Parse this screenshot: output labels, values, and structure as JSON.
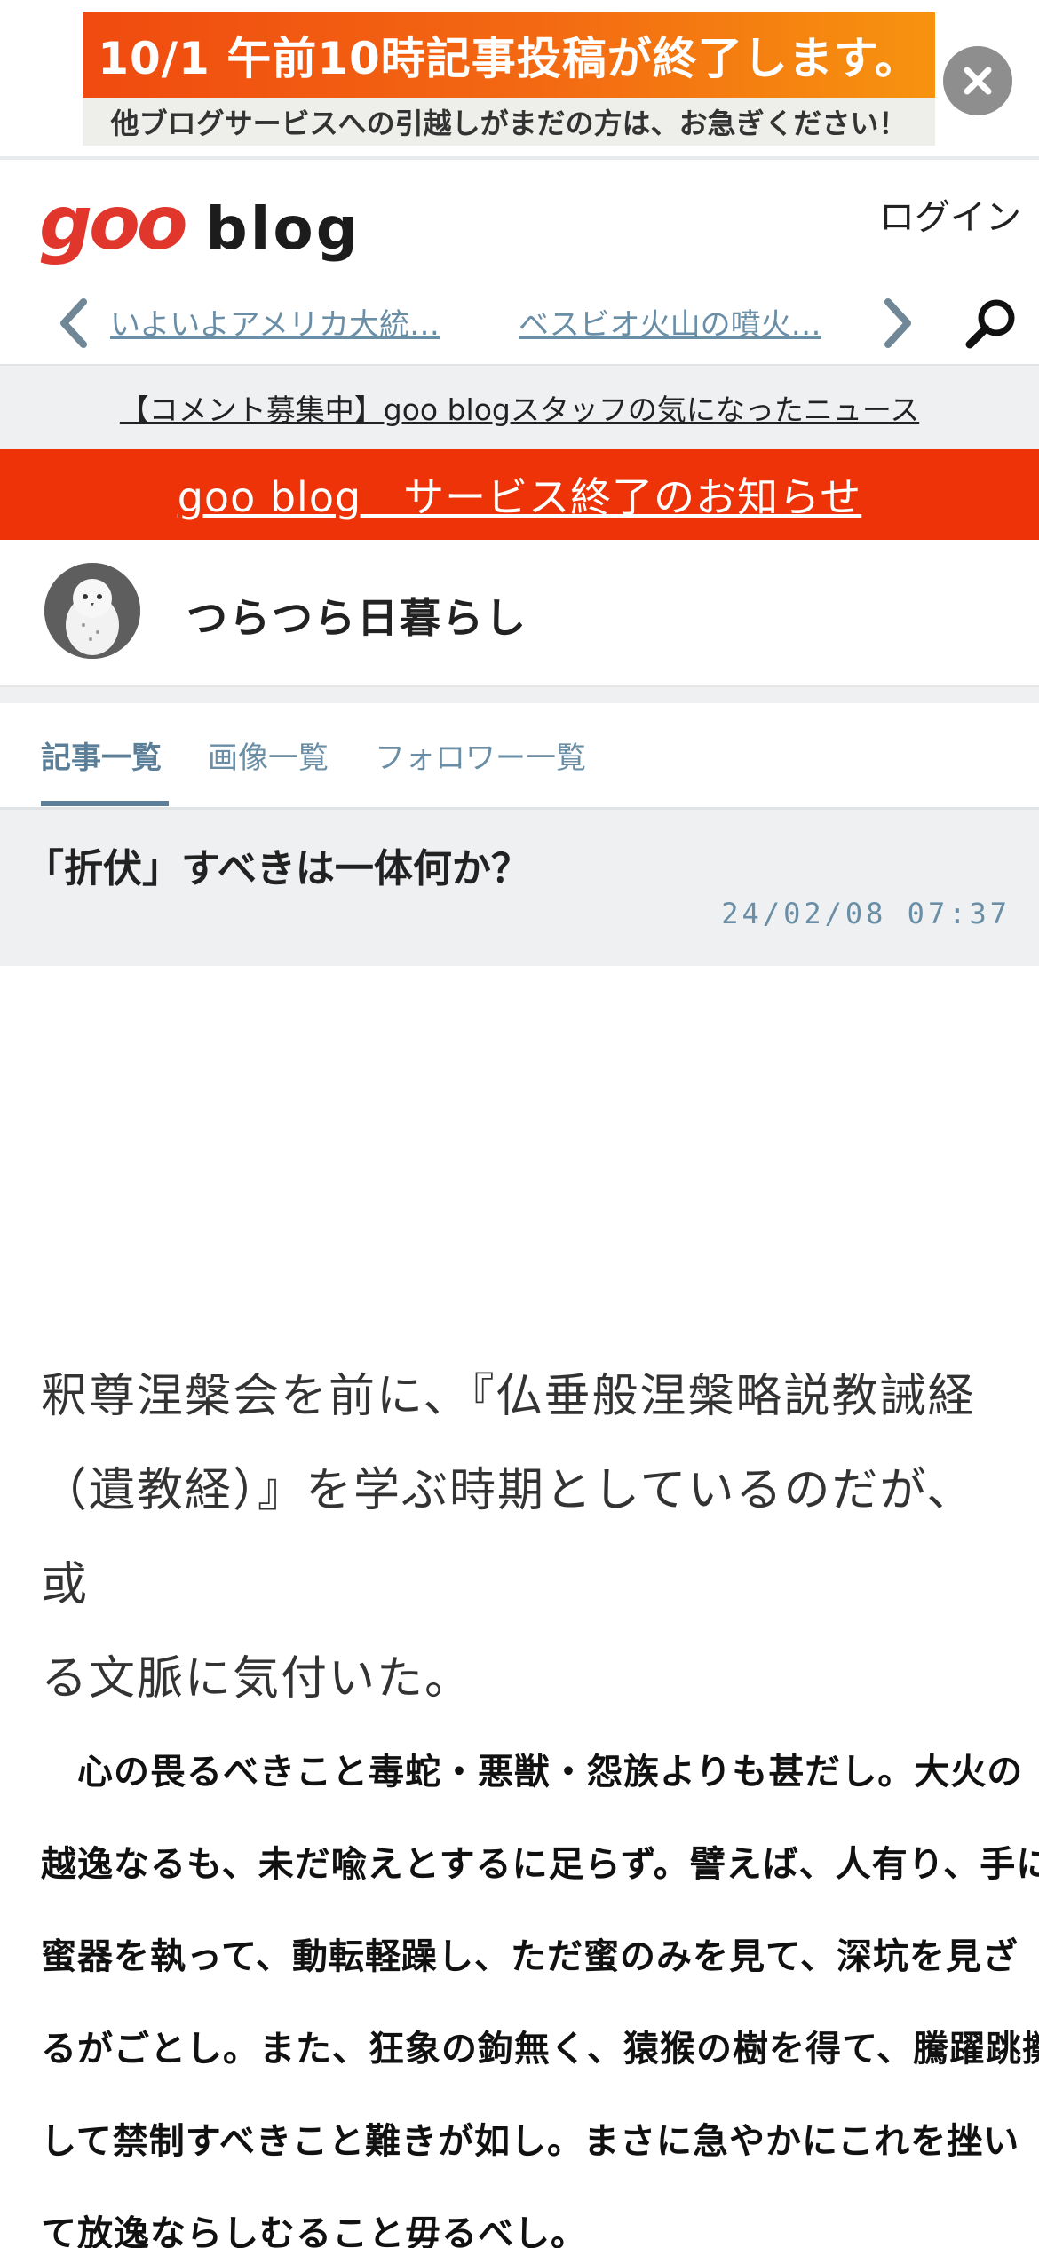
{
  "banner": {
    "headline": "10/1 午前10時記事投稿が終了します。",
    "subline": "他ブログサービスへの引越しがまだの方は、お急ぎください！"
  },
  "header": {
    "logo_goo": "goo",
    "logo_blog": "blog",
    "login_label": "ログイン",
    "news_links": [
      "いよいよアメリカ大統…",
      "ベスビオ火山の噴火…"
    ]
  },
  "comment_strip": "【コメント募集中】goo blogスタッフの気になったニュース",
  "notice": "goo blog　サービス終了のお知らせ",
  "blog": {
    "name": "つらつら日暮らし"
  },
  "tabs": [
    {
      "label": "記事一覧",
      "active": true
    },
    {
      "label": "画像一覧",
      "active": false
    },
    {
      "label": "フォロワー一覧",
      "active": false
    }
  ],
  "article": {
    "title": "「折伏」すべきは一体何か？",
    "date": "24/02/08 07:37",
    "intro_lines": [
      "釈尊涅槃会を前に、『仏垂般涅槃略説教誡経",
      "（遺教経）』を学ぶ時期としているのだが、或",
      "る文脈に気付いた。"
    ],
    "quote_lines": [
      "　心の畏るべきこと毒蛇・悪獣・怨族よりも甚だし。大火の",
      "越逸なるも、未だ喩えとするに足らず。譬えば、人有り、手に",
      "蜜器を執って、動転軽躁し、ただ蜜のみを見て、深坑を見ざ",
      "るがごとし。また、狂象の鉤無く、猿猴の樹を得て、騰躍跳擲",
      "して禁制すべきこと難きが如し。まさに急やかにこれを挫い",
      "て放逸ならしむること毋るべし。"
    ]
  }
}
